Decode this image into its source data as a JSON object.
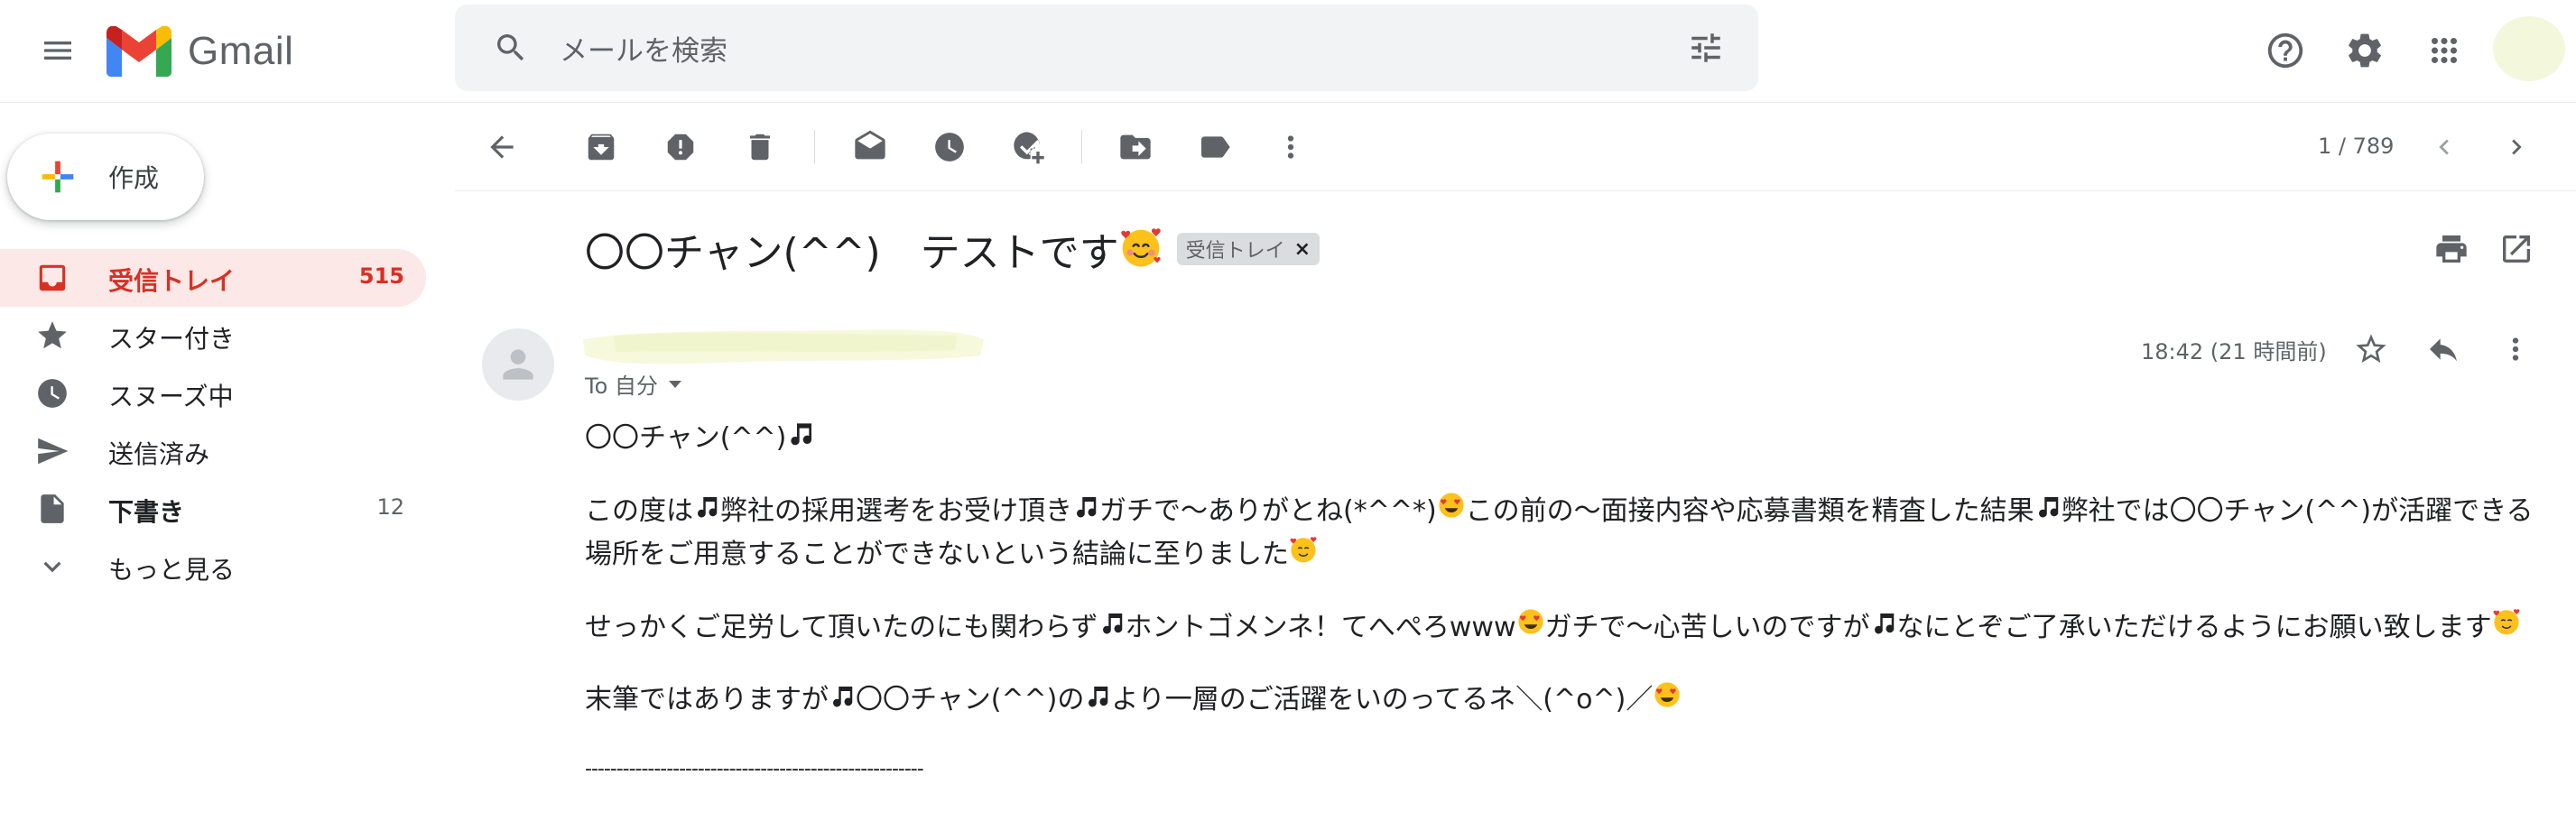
{
  "app": {
    "title": "Gmail",
    "search_placeholder": "メールを検索"
  },
  "sidebar": {
    "compose_label": "作成",
    "items": [
      {
        "label": "受信トレイ",
        "count": "515",
        "icon": "inbox-icon"
      },
      {
        "label": "スター付き",
        "count": "",
        "icon": "star-icon"
      },
      {
        "label": "スヌーズ中",
        "count": "",
        "icon": "clock-icon"
      },
      {
        "label": "送信済み",
        "count": "",
        "icon": "send-icon"
      },
      {
        "label": "下書き",
        "count": "12",
        "icon": "draft-icon"
      },
      {
        "label": "もっと見る",
        "count": "",
        "icon": "expand-more-icon"
      }
    ]
  },
  "toolbar": {
    "pager": "1 / 789"
  },
  "message": {
    "subject": "〇〇チャン(^^)　テストです",
    "label_chip": "受信トレイ",
    "label_chip_close": "×",
    "to_line": "To 自分",
    "time": "18:42 (21 時間前)",
    "body": {
      "greeting": "〇〇チャン(^^)",
      "p1a": "この度は",
      "p1b": "弊社の採用選考をお受け頂き",
      "p1c": "ガチで〜ありがとね(*^^*)",
      "p1d": "この前の〜面接内容や応募書類を精査した結果",
      "p1e": "弊社では〇〇チャン(^^)が活躍できる場所をご用意することができないという結論に至りました",
      "p2a": "せっかくご足労して頂いたのにも関わらず",
      "p2b": "ホントゴメンネ！てへぺろwww",
      "p2c": "ガチで〜心苦しいのですが",
      "p2d": "なにとぞご了承いただけるようにお願い致します",
      "p3a": "末筆ではありますが",
      "p3b": "〇〇チャン(^^)の",
      "p3c": "より一層のご活躍をいのってるネ＼(^o^)／",
      "divider": "------------------------------------------------------"
    }
  },
  "colors": {
    "accent_red": "#d93025",
    "active_bg": "#fce8e6",
    "icon_grey": "#5f6368"
  }
}
